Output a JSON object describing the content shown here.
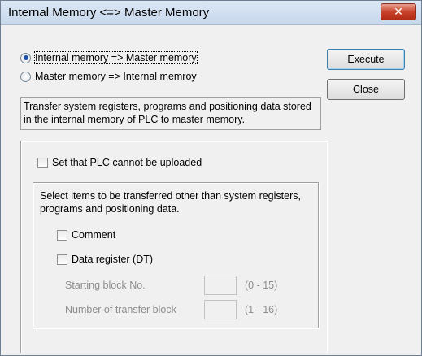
{
  "window": {
    "title": "Internal Memory <=> Master Memory",
    "close_glyph": "✕"
  },
  "direction": {
    "option1": "Internal memory => Master memory",
    "option2": "Master memory => Internal memroy",
    "selected": "option1"
  },
  "buttons": {
    "execute": "Execute",
    "close": "Close"
  },
  "description": "Transfer system registers, programs and positioning data stored in the internal memory of PLC to master memory.",
  "upload_lock": {
    "label": "Set that PLC cannot be uploaded",
    "checked": false
  },
  "transfer_items": {
    "instruction": "Select items to be transferred other than system registers, programs and positioning data.",
    "comment": {
      "label": "Comment",
      "checked": false
    },
    "data_register": {
      "label": "Data register (DT)",
      "checked": false
    },
    "starting_block": {
      "label": "Starting block No.",
      "value": "",
      "range": "(0 - 15)"
    },
    "transfer_blocks": {
      "label": "Number of transfer block",
      "value": "",
      "range": "(1 - 16)"
    }
  }
}
